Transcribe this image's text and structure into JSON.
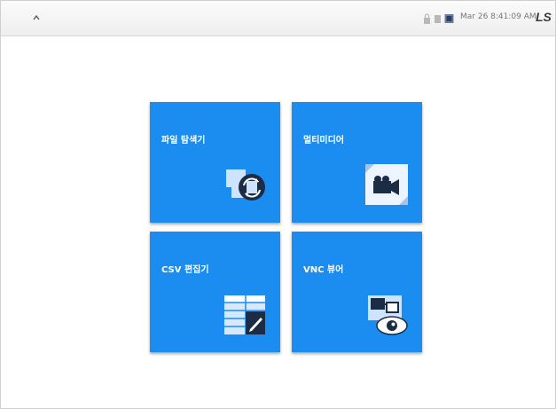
{
  "topbar": {
    "home_icon": "home-icon",
    "status_icons": [
      "lock-icon",
      "card-icon",
      "monitor-icon"
    ],
    "datetime": "Mar 26 8:41:09 AM",
    "logo": "LS"
  },
  "tiles": [
    {
      "label": "파일 탐색기",
      "icon": "file-sync-icon"
    },
    {
      "label": "멀티미디어",
      "icon": "video-camera-icon"
    },
    {
      "label": "CSV 편집기",
      "icon": "spreadsheet-edit-icon"
    },
    {
      "label": "VNC 뷰어",
      "icon": "remote-view-icon"
    }
  ],
  "colors": {
    "tile": "#1b8df0",
    "topbar": "#f2f2f2"
  }
}
